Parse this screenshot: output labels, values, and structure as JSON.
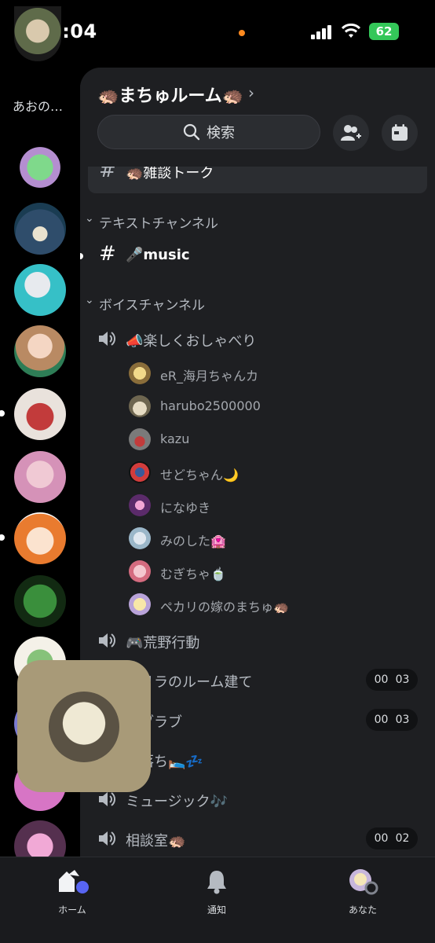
{
  "status_bar": {
    "time": "2:04",
    "battery": "62"
  },
  "rail": {
    "dm_label": "あおの…"
  },
  "server": {
    "title": "🦔まちゅルーム🦔"
  },
  "search": {
    "label": "検索"
  },
  "pinned_channel": {
    "name": "🦔雑談トーク"
  },
  "categories": {
    "text": "テキストチャンネル",
    "voice": "ボイスチャンネル"
  },
  "text_channels": [
    {
      "name": "🎤music"
    }
  ],
  "voice_channels": [
    {
      "name": "📣楽しくおしゃべり",
      "users": [
        "eR_海月ちゃんカ",
        "harubo2500000",
        "kazu",
        "せどちゃん🌙",
        "になゆき",
        "みのした🏩",
        "むぎちゃ🍵",
        "ペカリの嫁のまちゅ🦔"
      ]
    },
    {
      "name": "🎮荒野行動"
    },
    {
      "name": "ゲリラのルーム建て",
      "timer": [
        "00",
        "03"
      ]
    },
    {
      "name": "ラブラブ",
      "timer": [
        "00",
        "03"
      ]
    },
    {
      "name": "寝落ち🛌💤"
    },
    {
      "name": "ミュージック🎶"
    },
    {
      "name": "相談室🦔",
      "timer": [
        "00",
        "02"
      ]
    }
  ],
  "tabs": [
    {
      "label": "ホーム",
      "icon": "home-icon"
    },
    {
      "label": "通知",
      "icon": "bell-icon"
    },
    {
      "label": "あなた",
      "icon": "profile-icon"
    }
  ],
  "colors": {
    "background": "#000000",
    "panel": "#1e1f22",
    "accent": "#5865f2",
    "battery": "#34c759"
  }
}
